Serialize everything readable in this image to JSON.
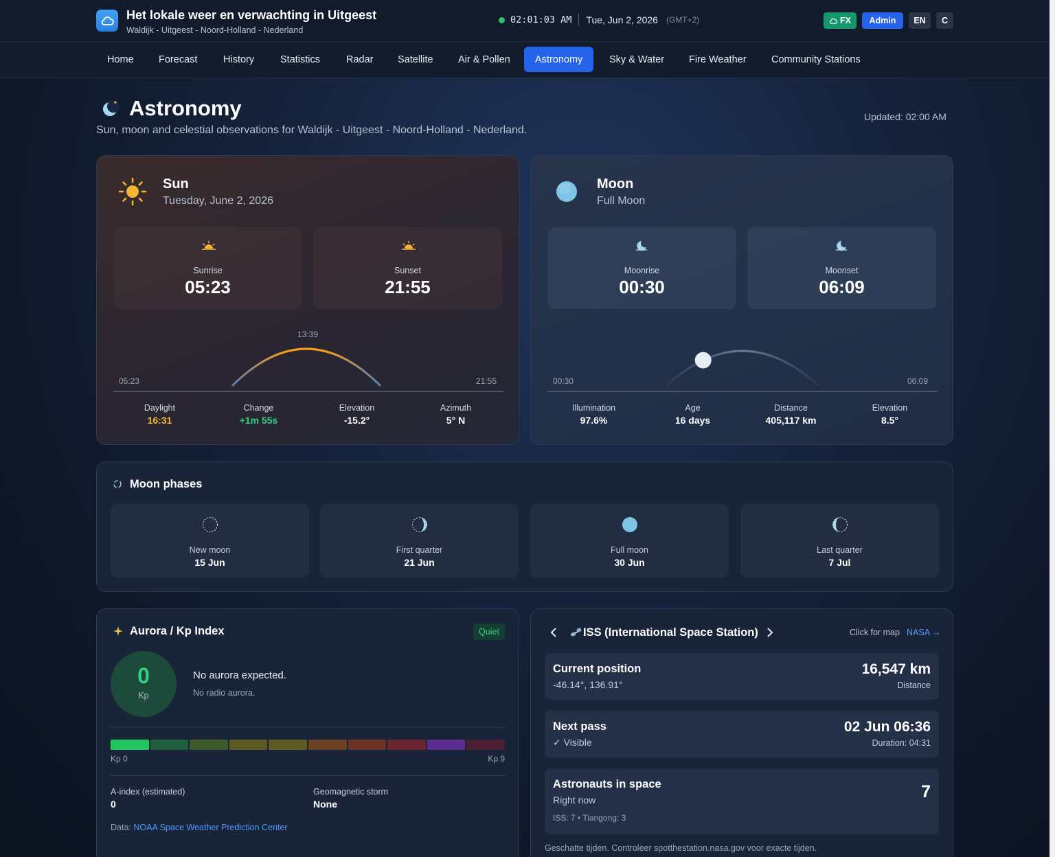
{
  "header": {
    "title": "Het lokale weer en verwachting in Uitgeest",
    "subtitle": "Waldijk - Uitgeest - Noord-Holland - Nederland",
    "time": "02:01:03 AM",
    "date": "Tue, Jun 2, 2026",
    "timezone": "(GMT+2)",
    "fx_label": "FX",
    "admin_label": "Admin",
    "lang_label": "EN",
    "c_label": "C"
  },
  "nav": {
    "tabs": [
      "Home",
      "Forecast",
      "History",
      "Statistics",
      "Radar",
      "Satellite",
      "Air & Pollen",
      "Astronomy",
      "Sky & Water",
      "Fire Weather",
      "Community Stations"
    ],
    "active": "Astronomy"
  },
  "page": {
    "title": "Astronomy",
    "subtitle": "Sun, moon and celestial observations for Waldijk - Uitgeest - Noord-Holland - Nederland.",
    "updated": "Updated: 02:00 AM"
  },
  "sun": {
    "title": "Sun",
    "date": "Tuesday, June 2, 2026",
    "sunrise_label": "Sunrise",
    "sunrise": "05:23",
    "sunset_label": "Sunset",
    "sunset": "21:55",
    "arc_start": "05:23",
    "arc_end": "21:55",
    "arc_peak": "13:39",
    "stats": {
      "daylight_label": "Daylight",
      "daylight": "16:31",
      "change_label": "Change",
      "change": "+1m 55s",
      "elevation_label": "Elevation",
      "elevation": "-15.2°",
      "azimuth_label": "Azimuth",
      "azimuth": "5° N"
    },
    "colors": {
      "daylight": "#f5b731",
      "change": "#34d07a"
    }
  },
  "moon": {
    "title": "Moon",
    "phase": "Full Moon",
    "moonrise_label": "Moonrise",
    "moonrise": "00:30",
    "moonset_label": "Moonset",
    "moonset": "06:09",
    "arc_start": "00:30",
    "arc_end": "06:09",
    "position_fraction": 0.26,
    "stats": {
      "illumination_label": "Illumination",
      "illumination": "97.6%",
      "age_label": "Age",
      "age": "16 days",
      "distance_label": "Distance",
      "distance": "405,117 km",
      "elevation_label": "Elevation",
      "elevation": "8.5°"
    }
  },
  "phases": {
    "title": "Moon phases",
    "items": [
      {
        "name": "New moon",
        "date": "15 Jun",
        "icon": "new-moon-icon"
      },
      {
        "name": "First quarter",
        "date": "21 Jun",
        "icon": "first-quarter-icon"
      },
      {
        "name": "Full moon",
        "date": "30 Jun",
        "icon": "full-moon-icon"
      },
      {
        "name": "Last quarter",
        "date": "7 Jul",
        "icon": "last-quarter-icon"
      }
    ]
  },
  "aurora": {
    "title": "Aurora / Kp Index",
    "badge": "Quiet",
    "kp_value": "0",
    "kp_unit": "Kp",
    "message": "No aurora expected.",
    "sub_message": "No radio aurora.",
    "scale_min": "Kp 0",
    "scale_max": "Kp 9",
    "a_index_label": "A-index (estimated)",
    "a_index": "0",
    "storm_label": "Geomagnetic storm",
    "storm": "None",
    "source_prefix": "Data:",
    "source_link": "NOAA Space Weather Prediction Center",
    "scale_colors": [
      "#22c55e",
      "#1f5f40",
      "#3d5a2a",
      "#5a5a22",
      "#5f5a20",
      "#6a3f22",
      "#6a3326",
      "#6a2630",
      "#5b2d8c",
      "#4a2032"
    ]
  },
  "iss": {
    "title": "ISS (International Space Station)",
    "click_map": "Click for map",
    "nasa": "NASA →",
    "position_title": "Current position",
    "position": "-46.14°, 136.91°",
    "distance": "16,547 km",
    "distance_label": "Distance",
    "next_pass_title": "Next pass",
    "next_pass_status": "✓ Visible",
    "next_pass": "02 Jun 06:36",
    "duration": "Duration: 04:31",
    "astronauts_title": "Astronauts in space",
    "astronauts_sub": "Right now",
    "astronauts_count": "7",
    "astronauts_detail": "ISS: 7 • Tiangong: 3",
    "footnote": "Geschatte tijden. Controleer spotthestation.nasa.gov voor exacte tijden."
  }
}
